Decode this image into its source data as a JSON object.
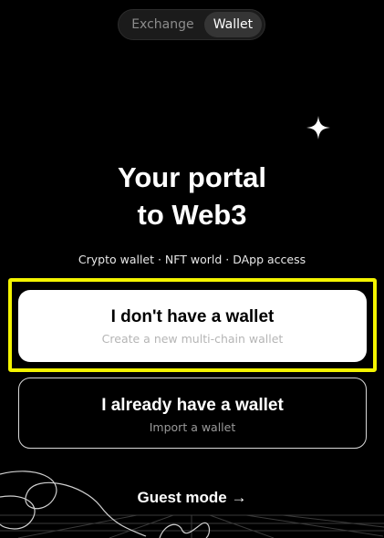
{
  "toggle": {
    "exchange_label": "Exchange",
    "wallet_label": "Wallet",
    "selected": "Wallet"
  },
  "hero": {
    "title_line1": "Your portal",
    "title_line2": "to Web3",
    "tagline": "Crypto wallet · NFT world · DApp access"
  },
  "options": {
    "create": {
      "title": "I don't have a wallet",
      "subtitle": "Create a new multi-chain wallet"
    },
    "import": {
      "title": "I already have a wallet",
      "subtitle": "Import a wallet"
    }
  },
  "guest": {
    "label": "Guest mode",
    "icon": "arrow-right-icon"
  },
  "icons": {
    "sparkle": "sparkle-icon"
  },
  "colors": {
    "background": "#000000",
    "highlight": "#f4f400",
    "primary_card": "#ffffff"
  }
}
